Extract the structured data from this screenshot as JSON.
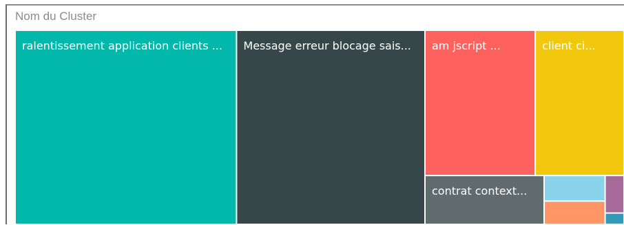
{
  "chart_data": {
    "type": "treemap",
    "legend_title": "Nom du Cluster",
    "tiles": [
      {
        "label": "ralentissement application clients ...",
        "value": 30.3,
        "color": "#01b8aa"
      },
      {
        "label": "Message erreur blocage sais...",
        "value": 25.8,
        "color": "#374649"
      },
      {
        "label": "am jscript ...",
        "value": 11.3,
        "color": "#fd625e"
      },
      {
        "label": "client ci...",
        "value": 9.1,
        "color": "#f2c80f"
      },
      {
        "label": "contrat context...",
        "value": 4.1,
        "color": "#5f6b6d"
      },
      {
        "label": "",
        "value": 1.1,
        "color": "#8ad4eb"
      },
      {
        "label": "",
        "value": 1.0,
        "color": "#fe9666"
      },
      {
        "label": "",
        "value": 0.5,
        "color": "#a66999"
      },
      {
        "label": "",
        "value": 0.15,
        "color": "#3599b8"
      }
    ]
  }
}
